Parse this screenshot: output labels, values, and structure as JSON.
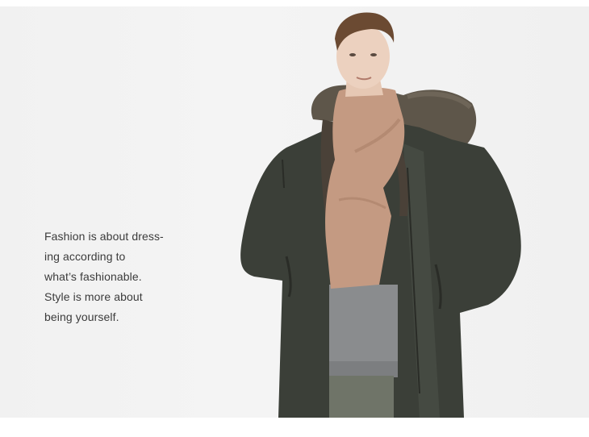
{
  "quote": {
    "lines": [
      "Fashion is about dress-",
      "ing according to",
      "what’s fashionable.",
      "Style is more about",
      "being yourself."
    ]
  },
  "colors": {
    "background": "#f2f2f2",
    "coat": "#3b3f38",
    "scarf": "#c49a82",
    "fur": "#5e564a",
    "sweater": "#8a8c8e",
    "text": "#3b3b3b"
  }
}
